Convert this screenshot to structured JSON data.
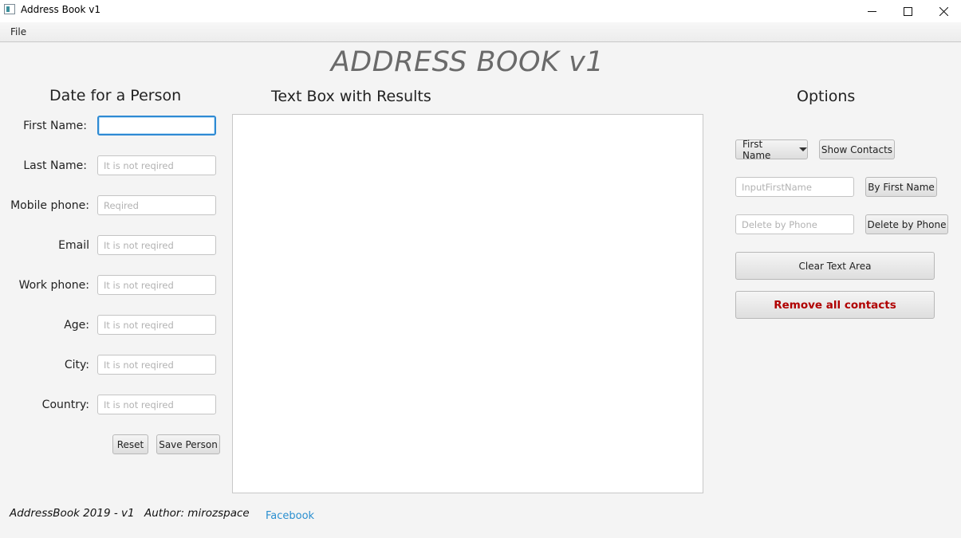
{
  "window": {
    "title": "Address Book v1"
  },
  "menu": {
    "file": "File"
  },
  "header": {
    "title": "ADDRESS BOOK v1"
  },
  "sections": {
    "person": "Date for a Person",
    "results": "Text Box with Results",
    "options": "Options"
  },
  "form": {
    "fields": [
      {
        "label": "First Name:",
        "placeholder": "",
        "value": ""
      },
      {
        "label": "Last Name:",
        "placeholder": "It is not reqired",
        "value": ""
      },
      {
        "label": "Mobile phone:",
        "placeholder": "Reqired",
        "value": ""
      },
      {
        "label": "Email",
        "placeholder": "It is not reqired",
        "value": ""
      },
      {
        "label": "Work phone:",
        "placeholder": "It is not reqired",
        "value": ""
      },
      {
        "label": "Age:",
        "placeholder": "It is not reqired",
        "value": ""
      },
      {
        "label": "City:",
        "placeholder": "It is not reqired",
        "value": ""
      },
      {
        "label": "Country:",
        "placeholder": "It is not reqired",
        "value": ""
      }
    ],
    "reset_label": "Reset",
    "save_label": "Save Person"
  },
  "results": {
    "text": ""
  },
  "options": {
    "sort_dropdown": "First Name",
    "show_contacts": "Show Contacts",
    "search_placeholder": "InputFirstName",
    "search_button": "By First Name",
    "delete_placeholder": "Delete by Phone",
    "delete_button": "Delete by Phone",
    "clear_button": "Clear Text Area",
    "remove_all_button": "Remove all contacts",
    "danger_color": "#b00000"
  },
  "footer": {
    "version": "AddressBook 2019 - v1",
    "author": "Author: mirozspace",
    "link": "Facebook"
  }
}
